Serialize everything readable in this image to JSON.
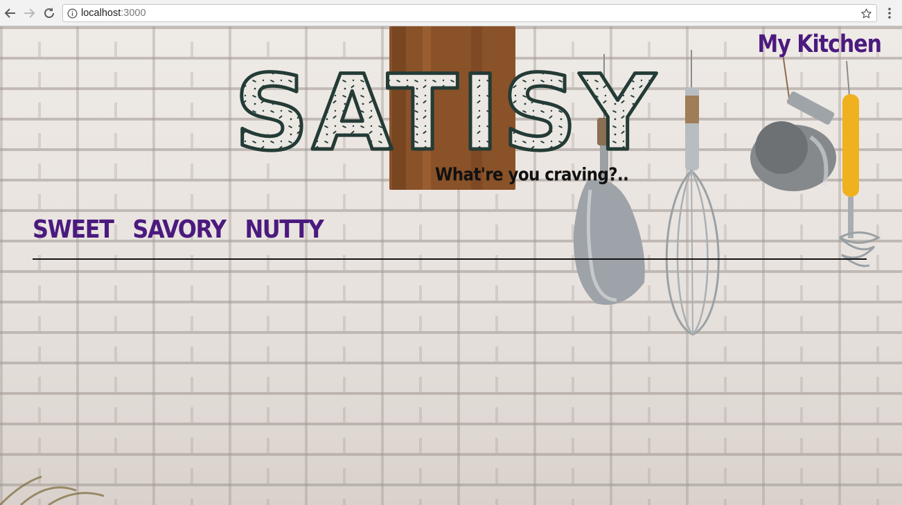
{
  "browser": {
    "url_host": "localhost",
    "url_port": ":3000",
    "icons": [
      "back-arrow-icon",
      "forward-arrow-icon",
      "reload-icon",
      "info-icon",
      "star-icon",
      "menu-dots-icon"
    ]
  },
  "header": {
    "my_kitchen_label": "My Kitchen",
    "logo_text": "SATISY",
    "tagline": "What're you craving?.."
  },
  "categories": [
    "SWEET",
    "SAVORY",
    "NUTTY"
  ],
  "colors": {
    "accent_purple": "#4b1a7e",
    "logo_outline": "#243b36",
    "logo_fill": "#e9e6e3",
    "text_dark": "#111111"
  }
}
